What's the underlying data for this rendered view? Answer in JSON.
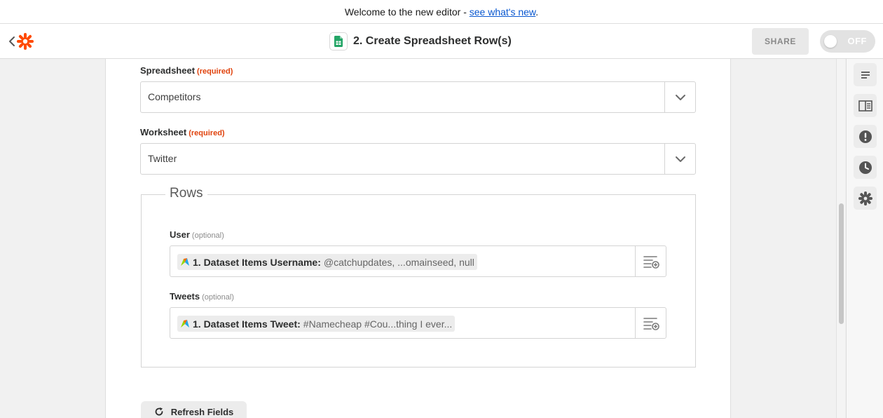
{
  "banner": {
    "text": "Welcome to the new editor - ",
    "link": "see what's new",
    "suffix": "."
  },
  "header": {
    "title": "2. Create Spreadsheet Row(s)",
    "share_label": "SHARE",
    "toggle_label": "OFF"
  },
  "form": {
    "spreadsheet": {
      "label": "Spreadsheet",
      "tag": "(required)",
      "value": "Competitors"
    },
    "worksheet": {
      "label": "Worksheet",
      "tag": "(required)",
      "value": "Twitter"
    },
    "rows": {
      "title": "Rows",
      "user": {
        "label": "User",
        "tag": "(optional)",
        "token_key": "1. Dataset Items Username:",
        "token_value": "@catchupdates, ...omainseed, null"
      },
      "tweets": {
        "label": "Tweets",
        "tag": "(optional)",
        "token_key": "1. Dataset Items Tweet:",
        "token_value": "#Namecheap #Cou...thing I ever..."
      }
    },
    "refresh_label": "Refresh Fields"
  },
  "icons": {
    "back": "chevron-left-icon",
    "logo": "zapier-logo-icon",
    "sheets": "google-sheets-icon",
    "rail": [
      "outline-icon",
      "guide-icon",
      "alert-icon",
      "history-icon",
      "settings-icon"
    ]
  },
  "colors": {
    "brand": "#ff4a00",
    "required": "#e0420c",
    "link": "#0a58d0",
    "sheets_green": "#23a566"
  }
}
